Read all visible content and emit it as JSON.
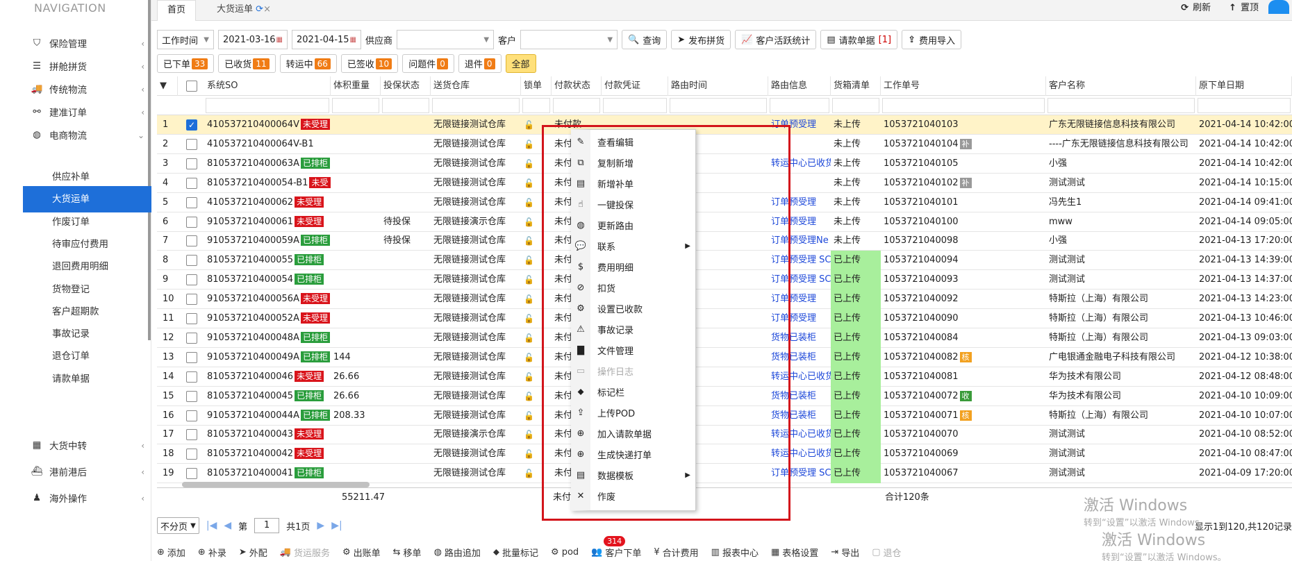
{
  "nav": {
    "title": "NAVIGATION",
    "items": [
      {
        "label": "保险管理",
        "icon": "shield-icon"
      },
      {
        "label": "拼舱拼货",
        "icon": "list-icon"
      },
      {
        "label": "传统物流",
        "icon": "truck-icon"
      },
      {
        "label": "建准订单",
        "icon": "link-icon"
      },
      {
        "label": "电商物流",
        "icon": "globe-icon"
      }
    ],
    "subitems": [
      "供应补单",
      "大货运单",
      "作废订单",
      "待审应付费用",
      "退回费用明细",
      "货物登记",
      "客户超期款",
      "事故记录",
      "退仓订单",
      "请款单据"
    ],
    "bottom": [
      {
        "label": "大货中转",
        "icon": "grid-icon"
      },
      {
        "label": "港前港后",
        "icon": "ship-icon"
      },
      {
        "label": "海外操作",
        "icon": "person-icon"
      }
    ]
  },
  "tabs": {
    "home": "首页",
    "current": "大货运单"
  },
  "top_actions": {
    "refresh": "刷新",
    "top": "置顶"
  },
  "filter": {
    "time_type": "工作时间",
    "date_from": "2021-03-16",
    "date_to": "2021-04-15",
    "supplier_label": "供应商",
    "supplier_value": "",
    "customer_label": "客户",
    "customer_value": "",
    "query": "查询",
    "publish": "发布拼货",
    "stats": "客户活跃统计",
    "invoice": "请款单据",
    "invoice_count": "[1]",
    "import": "费用导入"
  },
  "status_buttons": [
    {
      "label": "已下单",
      "count": "33"
    },
    {
      "label": "已收货",
      "count": "11"
    },
    {
      "label": "转运中",
      "count": "66"
    },
    {
      "label": "已签收",
      "count": "10"
    },
    {
      "label": "问题件",
      "count": "0"
    },
    {
      "label": "退件",
      "count": "0"
    },
    {
      "label": "全部",
      "count": ""
    }
  ],
  "columns": [
    "系统SO",
    "体积重量",
    "投保状态",
    "送货仓库",
    "锁单",
    "付款状态",
    "付款凭证",
    "路由时间",
    "路由信息",
    "货箱清单",
    "工作单号",
    "客户名称",
    "原下单日期"
  ],
  "rows": [
    {
      "n": "1",
      "so": "410537210400064V",
      "tag": "未受理",
      "tc": "r",
      "vol": "",
      "ins": "",
      "wh": "无限链接测试仓库",
      "pay": "未付款",
      "route": "订单预受理",
      "lst": "未上传",
      "work": "1053721040103",
      "wtag": "",
      "cust": "广东无限链接信息科技有限公司",
      "date": "2021-04-14 10:42:00",
      "chk": true
    },
    {
      "n": "2",
      "so": "410537210400064V-B1",
      "tag": "",
      "tc": "",
      "vol": "",
      "ins": "",
      "wh": "无限链接测试仓库",
      "pay": "未付",
      "route": "",
      "lst": "未上传",
      "work": "1053721040104",
      "wtag": "补",
      "cust": "----广东无限链接信息科技有限公司",
      "date": "2021-04-14 10:42:00"
    },
    {
      "n": "3",
      "so": "810537210400063A",
      "tag": "已排柜",
      "tc": "g",
      "vol": "",
      "ins": "",
      "wh": "无限链接测试仓库",
      "pay": "未付",
      "route": "转运中心已收货",
      "lst": "未上传",
      "work": "1053721040105",
      "wtag": "",
      "cust": "小强",
      "date": "2021-04-14 10:42:00"
    },
    {
      "n": "4",
      "so": "810537210400054-B1",
      "tag": "未受",
      "tc": "r",
      "vol": "",
      "ins": "",
      "wh": "无限链接测试仓库",
      "pay": "未付",
      "route": "",
      "lst": "未上传",
      "work": "1053721040102",
      "wtag": "补",
      "cust": "测试测试",
      "date": "2021-04-14 10:15:00"
    },
    {
      "n": "5",
      "so": "410537210400062",
      "tag": "未受理",
      "tc": "r",
      "vol": "",
      "ins": "",
      "wh": "无限链接测试仓库",
      "pay": "未付",
      "route": "订单预受理",
      "lst": "未上传",
      "work": "1053721040101",
      "wtag": "",
      "cust": "冯先生1",
      "date": "2021-04-14 09:41:00"
    },
    {
      "n": "6",
      "so": "910537210400061",
      "tag": "未受理",
      "tc": "r",
      "vol": "",
      "ins": "待投保",
      "wh": "无限链接演示仓库",
      "pay": "未付",
      "route": "订单预受理",
      "lst": "未上传",
      "work": "1053721040100",
      "wtag": "",
      "cust": "mww",
      "date": "2021-04-14 09:05:00"
    },
    {
      "n": "7",
      "so": "910537210400059A",
      "tag": "已排柜",
      "tc": "g",
      "vol": "",
      "ins": "待投保",
      "wh": "无限链接测试仓库",
      "pay": "未付",
      "route": "订单预受理Ne",
      "lst": "未上传",
      "work": "1053721040098",
      "wtag": "",
      "cust": "小强",
      "date": "2021-04-13 17:20:00"
    },
    {
      "n": "8",
      "so": "810537210400055",
      "tag": "已排柜",
      "tc": "g",
      "vol": "",
      "ins": "",
      "wh": "无限链接测试仓库",
      "pay": "未付",
      "route": "订单预受理 SC",
      "lst": "已上传",
      "work": "1053721040094",
      "wtag": "",
      "cust": "测试测试",
      "date": "2021-04-13 14:39:00"
    },
    {
      "n": "9",
      "so": "810537210400054",
      "tag": "已排柜",
      "tc": "g",
      "vol": "",
      "ins": "",
      "wh": "无限链接测试仓库",
      "pay": "未付",
      "route": "订单预受理 SC",
      "lst": "已上传",
      "work": "1053721040093",
      "wtag": "",
      "cust": "测试测试",
      "date": "2021-04-13 14:37:00"
    },
    {
      "n": "10",
      "so": "910537210400056A",
      "tag": "未受理",
      "tc": "r",
      "vol": "",
      "ins": "",
      "wh": "无限链接测试仓库",
      "pay": "未付",
      "route": "订单预受理",
      "lst": "已上传",
      "work": "1053721040092",
      "wtag": "",
      "cust": "特斯拉（上海）有限公司",
      "date": "2021-04-13 14:23:00"
    },
    {
      "n": "11",
      "so": "910537210400052A",
      "tag": "未受理",
      "tc": "r",
      "vol": "",
      "ins": "",
      "wh": "无限链接测试仓库",
      "pay": "未付",
      "route": "订单预受理",
      "lst": "已上传",
      "work": "1053721040090",
      "wtag": "",
      "cust": "特斯拉（上海）有限公司",
      "date": "2021-04-13 10:46:00"
    },
    {
      "n": "12",
      "so": "910537210400048A",
      "tag": "已排柜",
      "tc": "g",
      "vol": "",
      "ins": "",
      "wh": "无限链接测试仓库",
      "pay": "未付",
      "route": "货物已装柜",
      "lst": "已上传",
      "work": "1053721040084",
      "wtag": "",
      "cust": "特斯拉（上海）有限公司",
      "date": "2021-04-13 09:03:00"
    },
    {
      "n": "13",
      "so": "910537210400049A",
      "tag": "已排柜",
      "tc": "g",
      "vol": "144",
      "ins": "",
      "wh": "无限链接测试仓库",
      "pay": "未付",
      "route": "货物已装柜",
      "lst": "已上传",
      "work": "1053721040082",
      "wtag": "核",
      "cust": "广电银通金融电子科技有限公司",
      "date": "2021-04-12 10:38:00"
    },
    {
      "n": "14",
      "so": "810537210400046",
      "tag": "未受理",
      "tc": "r",
      "vol": "26.66",
      "ins": "",
      "wh": "无限链接测试仓库",
      "pay": "未付",
      "route": "转运中心已收货",
      "lst": "已上传",
      "work": "1053721040081",
      "wtag": "",
      "cust": "华为技术有限公司",
      "date": "2021-04-12 08:48:00"
    },
    {
      "n": "15",
      "so": "810537210400045",
      "tag": "已排柜",
      "tc": "g",
      "vol": "26.66",
      "ins": "",
      "wh": "无限链接测试仓库",
      "pay": "未付",
      "route": "货物已装柜",
      "lst": "已上传",
      "work": "1053721040072",
      "wtag": "收",
      "cust": "华为技术有限公司",
      "date": "2021-04-10 10:09:00"
    },
    {
      "n": "16",
      "so": "910537210400044A",
      "tag": "已排柜",
      "tc": "g",
      "vol": "208.33",
      "ins": "",
      "wh": "无限链接测试仓库",
      "pay": "未付",
      "route": "货物已装柜",
      "lst": "已上传",
      "work": "1053721040071",
      "wtag": "核",
      "cust": "特斯拉（上海）有限公司",
      "date": "2021-04-10 10:07:00"
    },
    {
      "n": "17",
      "so": "810537210400043",
      "tag": "未受理",
      "tc": "r",
      "vol": "",
      "ins": "",
      "wh": "无限链接演示仓库",
      "pay": "未付",
      "route": "转运中心已收货",
      "lst": "已上传",
      "work": "1053721040070",
      "wtag": "",
      "cust": "测试测试",
      "date": "2021-04-10 08:52:00"
    },
    {
      "n": "18",
      "so": "810537210400042",
      "tag": "未受理",
      "tc": "r",
      "vol": "",
      "ins": "",
      "wh": "无限链接测试仓库",
      "pay": "未付",
      "route": "转运中心已收货",
      "lst": "已上传",
      "work": "1053721040069",
      "wtag": "",
      "cust": "测试测试",
      "date": "2021-04-10 08:47:00"
    },
    {
      "n": "19",
      "so": "810537210400041",
      "tag": "已排柜",
      "tc": "g",
      "vol": "",
      "ins": "",
      "wh": "无限链接测试仓库",
      "pay": "未付",
      "route": "订单预受理 SC",
      "lst": "已上传",
      "work": "1053721040067",
      "wtag": "",
      "cust": "测试测试",
      "date": "2021-04-09 17:20:00"
    }
  ],
  "summary": {
    "volume": "55211.47",
    "pay": "未付",
    "count": "合计120条"
  },
  "menu": [
    {
      "label": "查看编辑",
      "icon": "pencil-icon"
    },
    {
      "label": "复制新增",
      "icon": "copy-icon"
    },
    {
      "label": "新增补单",
      "icon": "add-doc-icon"
    },
    {
      "label": "一键投保",
      "icon": "hand-icon"
    },
    {
      "label": "更新路由",
      "icon": "globe-icon"
    },
    {
      "label": "联系",
      "icon": "chat-icon",
      "sub": true
    },
    {
      "label": "费用明细",
      "icon": "dollar-icon"
    },
    {
      "label": "扣货",
      "icon": "ban-icon"
    },
    {
      "label": "设置已收款",
      "icon": "gear-icon"
    },
    {
      "label": "事故记录",
      "icon": "warning-icon"
    },
    {
      "label": "文件管理",
      "icon": "file-icon"
    },
    {
      "label": "操作日志",
      "icon": "log-icon",
      "disabled": true
    },
    {
      "label": "标记栏",
      "icon": "tag-icon"
    },
    {
      "label": "上传POD",
      "icon": "upload-icon"
    },
    {
      "label": "加入请款单据",
      "icon": "plus-circle-icon"
    },
    {
      "label": "生成快递打单",
      "icon": "plus-circle-icon"
    },
    {
      "label": "数据模板",
      "icon": "template-icon",
      "sub": true
    },
    {
      "label": "作废",
      "icon": "x-icon"
    }
  ],
  "pager": {
    "size": "不分页",
    "page_label": "第",
    "page": "1",
    "total_pages": "共1页",
    "info": "显示1到120,共120记录"
  },
  "watermark": {
    "title": "激活 Windows",
    "hint": "转到“设置”以激活 Windows。"
  },
  "bottom_toolbar": [
    {
      "label": "添加",
      "icon": "plus-icon"
    },
    {
      "label": "补录",
      "icon": "plus-icon"
    },
    {
      "label": "外配",
      "icon": "send-icon"
    },
    {
      "label": "货运服务",
      "icon": "truck-icon",
      "disabled": true
    },
    {
      "label": "出账单",
      "icon": "gear-icon"
    },
    {
      "label": "移单",
      "icon": "move-icon"
    },
    {
      "label": "路由追加",
      "icon": "globe-icon"
    },
    {
      "label": "批量标记",
      "icon": "tag-icon"
    },
    {
      "label": "pod",
      "icon": "gear-icon"
    },
    {
      "label": "客户下单",
      "icon": "users-icon",
      "badge": "314"
    },
    {
      "label": "合计费用",
      "icon": "yen-icon"
    },
    {
      "label": "报表中心",
      "icon": "chart-icon"
    },
    {
      "label": "表格设置",
      "icon": "table-icon"
    },
    {
      "label": "导出",
      "icon": "export-icon"
    },
    {
      "label": "退仓",
      "icon": "doc-icon",
      "disabled": true
    }
  ],
  "colors": {
    "accent": "#1e6fd9",
    "danger": "#d9141b",
    "success": "#2a9d3c",
    "badge": "#f07c15",
    "highlight": "#fff3c8",
    "uploaded": "#a8ef9c"
  }
}
